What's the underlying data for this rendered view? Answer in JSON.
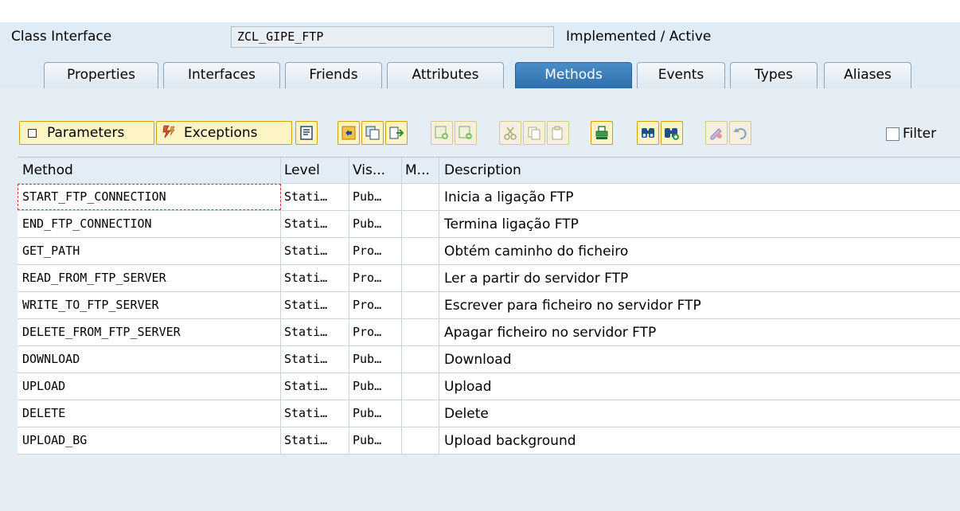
{
  "header": {
    "label": "Class Interface",
    "class_name": "ZCL_GIPE_FTP",
    "status": "Implemented / Active"
  },
  "tabs": [
    {
      "label": "Properties",
      "active": false
    },
    {
      "label": "Interfaces",
      "active": false
    },
    {
      "label": "Friends",
      "active": false
    },
    {
      "label": "Attributes",
      "active": false
    },
    {
      "label": "Methods",
      "active": true
    },
    {
      "label": "Events",
      "active": false
    },
    {
      "label": "Types",
      "active": false
    },
    {
      "label": "Aliases",
      "active": false
    }
  ],
  "toolbar": {
    "parameters_label": "Parameters",
    "exceptions_label": "Exceptions",
    "filter_label": "Filter",
    "filter_checked": false,
    "icons": [
      "source-code-icon",
      "navigate-icon",
      "copy-icon",
      "insert-icon",
      "insert-row-icon",
      "delete-row-icon",
      "cut-icon",
      "copy-rows-icon",
      "paste-icon",
      "print-icon",
      "find-icon",
      "find-next-icon",
      "redefine-icon",
      "undo-icon"
    ]
  },
  "table": {
    "columns": [
      "Method",
      "Level",
      "Vis...",
      "M...",
      "Description"
    ],
    "rows": [
      {
        "method": "START_FTP_CONNECTION",
        "level": "Stati…",
        "vis": "Pub…",
        "m": "",
        "description": "Inicia a ligação FTP"
      },
      {
        "method": "END_FTP_CONNECTION",
        "level": "Stati…",
        "vis": "Pub…",
        "m": "",
        "description": "Termina ligação FTP"
      },
      {
        "method": "GET_PATH",
        "level": "Stati…",
        "vis": "Pro…",
        "m": "",
        "description": "Obtém caminho do ficheiro"
      },
      {
        "method": "READ_FROM_FTP_SERVER",
        "level": "Stati…",
        "vis": "Pro…",
        "m": "",
        "description": "Ler a partir do servidor FTP"
      },
      {
        "method": "WRITE_TO_FTP_SERVER",
        "level": "Stati…",
        "vis": "Pro…",
        "m": "",
        "description": "Escrever para ficheiro no servidor FTP"
      },
      {
        "method": "DELETE_FROM_FTP_SERVER",
        "level": "Stati…",
        "vis": "Pro…",
        "m": "",
        "description": "Apagar ficheiro no servidor FTP"
      },
      {
        "method": "DOWNLOAD",
        "level": "Stati…",
        "vis": "Pub…",
        "m": "",
        "description": "Download"
      },
      {
        "method": "UPLOAD",
        "level": "Stati…",
        "vis": "Pub…",
        "m": "",
        "description": "Upload"
      },
      {
        "method": "DELETE",
        "level": "Stati…",
        "vis": "Pub…",
        "m": "",
        "description": "Delete"
      },
      {
        "method": "UPLOAD_BG",
        "level": "Stati…",
        "vis": "Pub…",
        "m": "",
        "description": "Upload background"
      }
    ]
  },
  "colors": {
    "active_tab": "#2f6fab",
    "button_bg": "#fcf4c4",
    "button_border": "#d2a000",
    "panel_bg": "#e6eef5"
  }
}
